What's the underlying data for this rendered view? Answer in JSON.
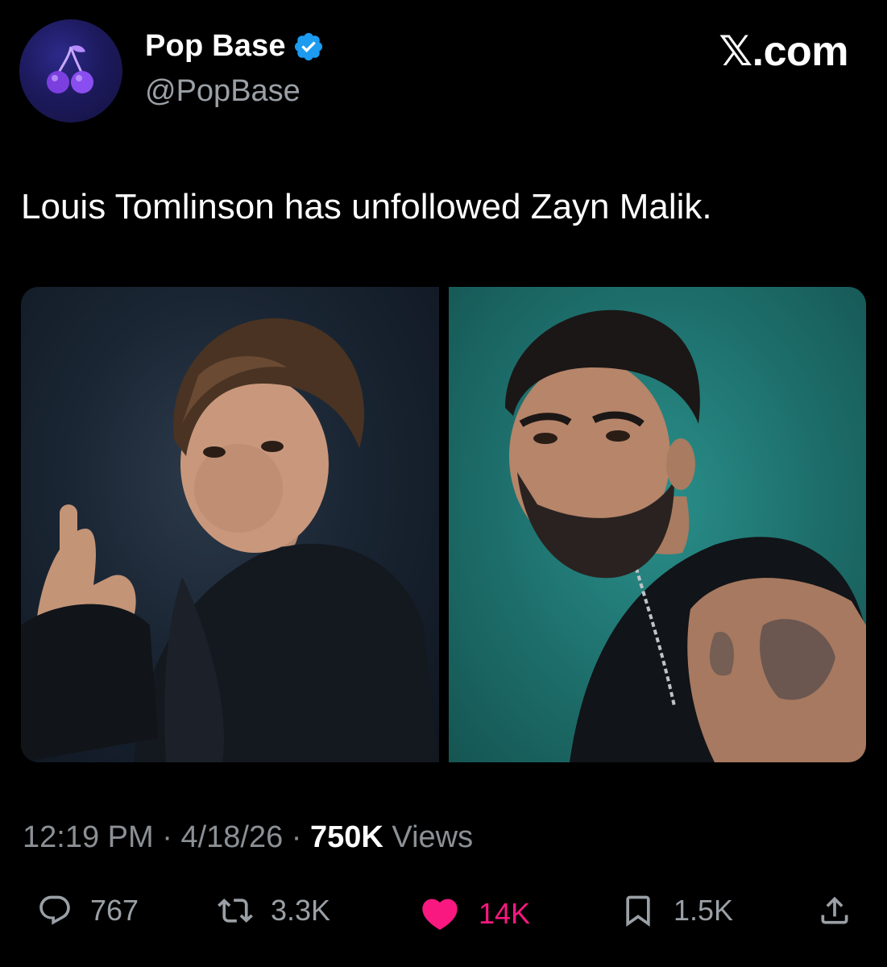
{
  "header": {
    "display_name": "Pop Base",
    "handle": "@PopBase",
    "brand": "𝕏.com",
    "avatar_icon": "cherries-icon",
    "verified_icon": "verified-badge-icon"
  },
  "tweet": {
    "text": "Louis Tomlinson has unfollowed Zayn Malik."
  },
  "media": {
    "images": [
      {
        "subject": "Louis Tomlinson portrait"
      },
      {
        "subject": "Zayn Malik portrait"
      }
    ]
  },
  "meta": {
    "time": "12:19 PM",
    "separator": " · ",
    "date": "4/18/26",
    "views_count": "750K",
    "views_label": " Views"
  },
  "actions": {
    "replies": "767",
    "reposts": "3.3K",
    "likes": "14K",
    "bookmarks": "1.5K"
  },
  "colors": {
    "background": "#000000",
    "verified": "#1d9bf0",
    "like": "#f91880",
    "muted": "#8b9095"
  }
}
